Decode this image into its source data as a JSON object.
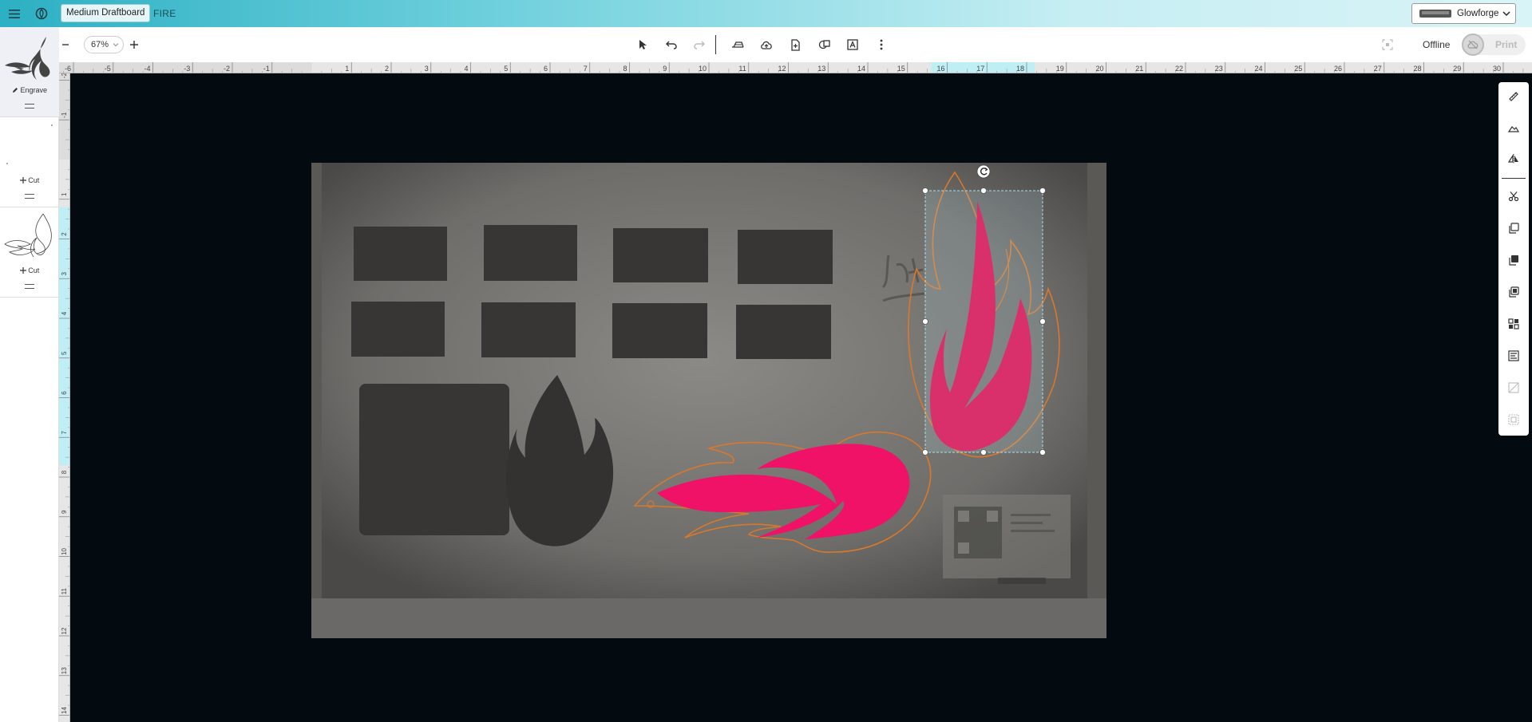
{
  "topbar": {
    "material": "Medium Draftboard",
    "design_name": "FIRE",
    "printer": "Glowforge"
  },
  "toolbar": {
    "zoom": "67%",
    "status": "Offline",
    "print_label": "Print"
  },
  "steps": [
    {
      "mode": "Engrave"
    },
    {
      "mode": "Cut"
    },
    {
      "mode": "Cut"
    }
  ],
  "rulers": {
    "horizontal": [
      "-6",
      "-5",
      "-4",
      "-3",
      "-2",
      "-1",
      "1",
      "2",
      "3",
      "4",
      "5",
      "6",
      "7",
      "8",
      "9",
      "10",
      "11",
      "12",
      "13",
      "14",
      "15",
      "16",
      "17",
      "18",
      "19",
      "20",
      "21",
      "22",
      "23",
      "24",
      "25",
      "26",
      "27",
      "28",
      "29",
      "30"
    ],
    "vertical": [
      "-2",
      "-1",
      "1",
      "2",
      "3",
      "4",
      "5",
      "6",
      "7",
      "8",
      "9",
      "10",
      "11",
      "12",
      "13",
      "14"
    ]
  },
  "colors": {
    "accent": "#2cb0c3",
    "artwork": "#e8135f",
    "cut_outline": "#e07a2e",
    "canvas_bg": "#040b10",
    "ruler_highlight": "#bfeef5"
  },
  "icons": {
    "menu": "hamburger-icon",
    "logo": "glowforge-logo-icon",
    "undo": "undo-icon",
    "redo": "redo-icon",
    "select": "cursor-arrow-icon"
  }
}
